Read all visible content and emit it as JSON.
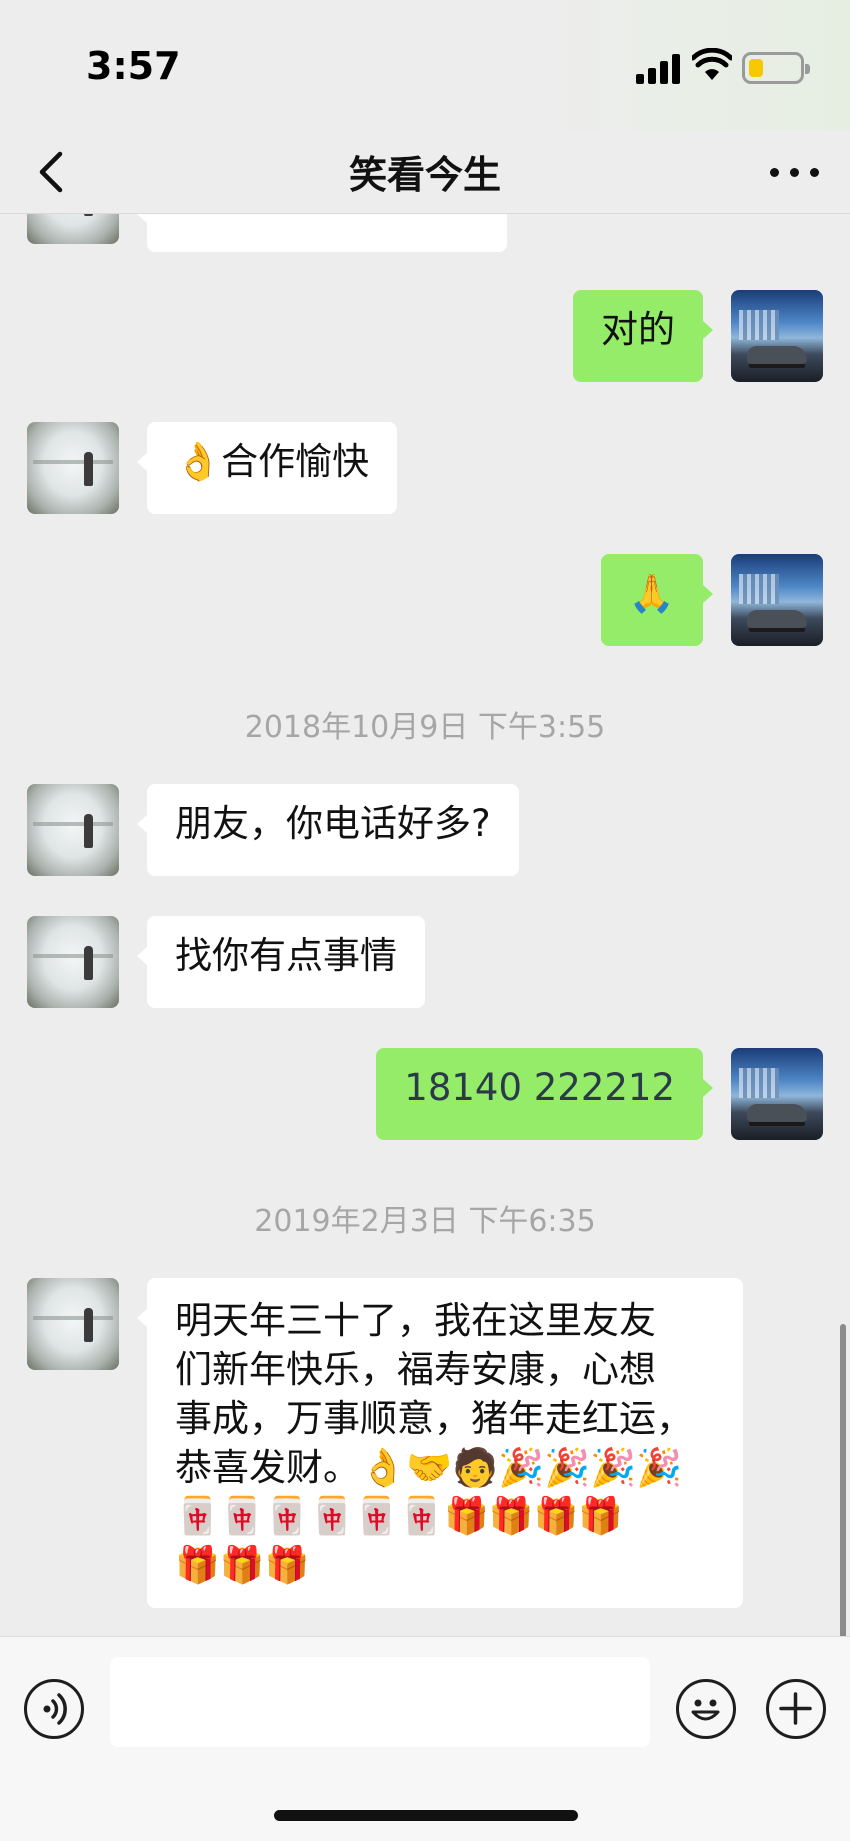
{
  "status_bar": {
    "time": "3:57",
    "battery_level": 0.3,
    "battery_color": "#f6c800"
  },
  "nav": {
    "title": "笑看今生",
    "back_icon": "chevron-left-icon",
    "more_icon": "more-dots-icon"
  },
  "chat": {
    "partial_top_text": "",
    "messages": [
      {
        "kind": "text",
        "side": "out",
        "text": "对的"
      },
      {
        "kind": "text",
        "side": "in",
        "text": "👌合作愉快"
      },
      {
        "kind": "text",
        "side": "out",
        "text": "🙏"
      },
      {
        "kind": "timestamp",
        "text": "2018年10月9日 下午3:55"
      },
      {
        "kind": "text",
        "side": "in",
        "text": "朋友，你电话好多?"
      },
      {
        "kind": "text",
        "side": "in",
        "text": "找你有点事情"
      },
      {
        "kind": "text",
        "side": "out",
        "text": "18140 222212"
      },
      {
        "kind": "timestamp",
        "text": "2019年2月3日 下午6:35"
      },
      {
        "kind": "text",
        "side": "in",
        "lines": [
          "明天年三十了，我在这里友友",
          "们新年快乐，福寿安康，心想",
          "事成，万事顺意，猪年走红运，",
          "恭喜发财。👌🤝🧑🎉🎉🎉🎉",
          "🀄🀄🀄🀄🀄🀄🎁🎁🎁🎁",
          "🎁🎁🎁"
        ]
      }
    ]
  },
  "colors": {
    "outgoing_bubble": "#95ec69",
    "incoming_bubble": "#ffffff",
    "background": "#ededed"
  },
  "input_bar": {
    "placeholder": "",
    "voice_icon": "voice-icon",
    "emoji_icon": "emoji-face-icon",
    "plus_icon": "plus-circle-icon"
  }
}
